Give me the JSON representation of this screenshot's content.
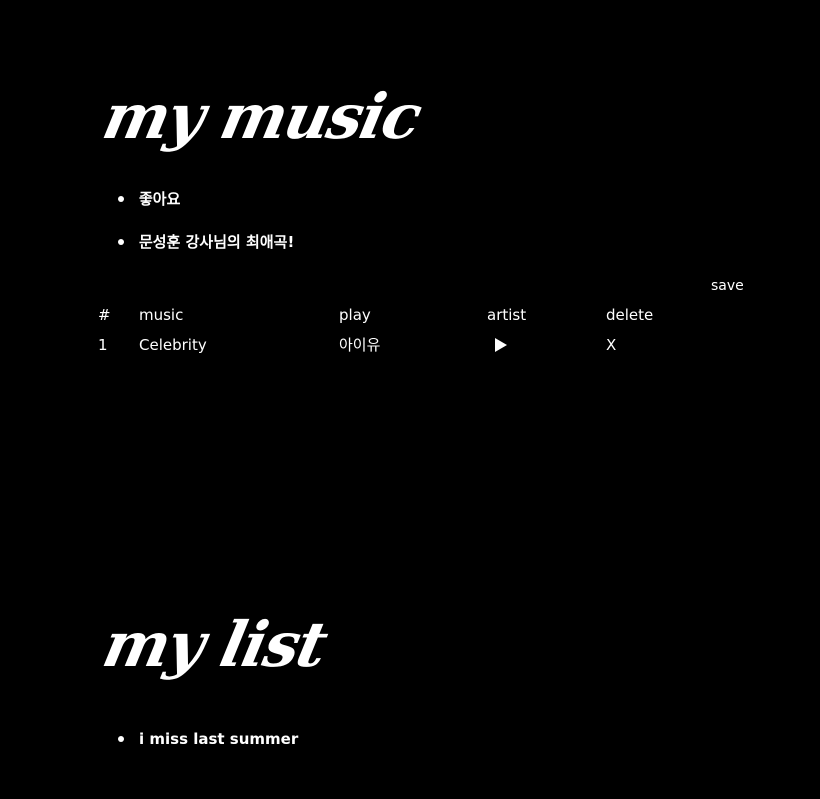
{
  "sections": {
    "music_title": "my music",
    "list_title": "my list"
  },
  "likes": [
    "좋아요",
    "문성훈 강사님의 최애곡!"
  ],
  "toolbar": {
    "save_label": "save"
  },
  "table": {
    "headers": {
      "num": "#",
      "music": "music",
      "play": "play",
      "artist": "artist",
      "delete": "delete"
    },
    "rows": [
      {
        "num": "1",
        "music": "Celebrity",
        "play": "아이유",
        "artist_icon": "play-icon",
        "delete": "X"
      }
    ]
  },
  "my_list": [
    "i miss last summer"
  ],
  "colors": {
    "background": "#000000",
    "text": "#ffffff"
  }
}
